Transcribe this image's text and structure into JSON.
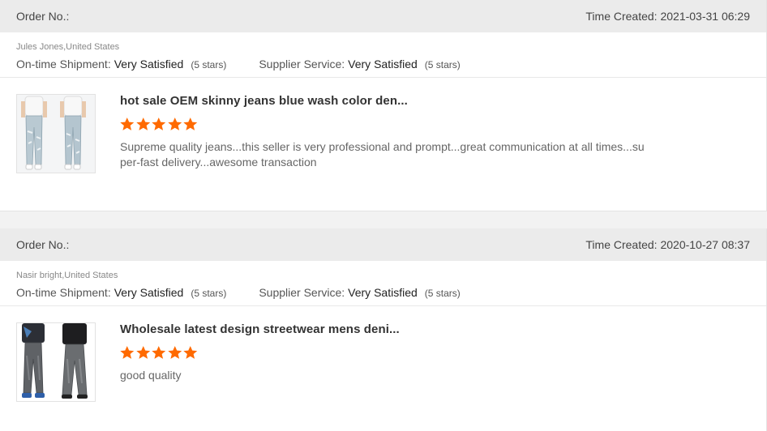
{
  "reviews": [
    {
      "order_label": "Order No.:",
      "time_created": "Time Created: 2021-03-31 06:29",
      "buyer": "Jules Jones,United States",
      "shipment_label": "On-time Shipment:",
      "shipment_value": "Very Satisfied",
      "shipment_count": "(5 stars)",
      "service_label": "Supplier Service:",
      "service_value": "Very Satisfied",
      "service_count": "(5 stars)",
      "product_title": "hot sale OEM skinny jeans blue wash color den...",
      "rating": 5,
      "comment": "Supreme quality jeans...this seller is very professional and prompt...great communication at all times...super-fast delivery...awesome transaction",
      "thumb_icon": "light-wash-jeans-product-image"
    },
    {
      "order_label": "Order No.:",
      "time_created": "Time Created: 2020-10-27 08:37",
      "buyer": "Nasir bright,United States",
      "shipment_label": "On-time Shipment:",
      "shipment_value": "Very Satisfied",
      "shipment_count": "(5 stars)",
      "service_label": "Supplier Service:",
      "service_value": "Very Satisfied",
      "service_count": "(5 stars)",
      "product_title": "Wholesale latest design streetwear mens deni...",
      "rating": 5,
      "comment": "good quality",
      "thumb_icon": "dark-flared-jeans-product-image"
    }
  ],
  "colors": {
    "star": "#ff6a00",
    "header_bg": "#ebebeb"
  }
}
